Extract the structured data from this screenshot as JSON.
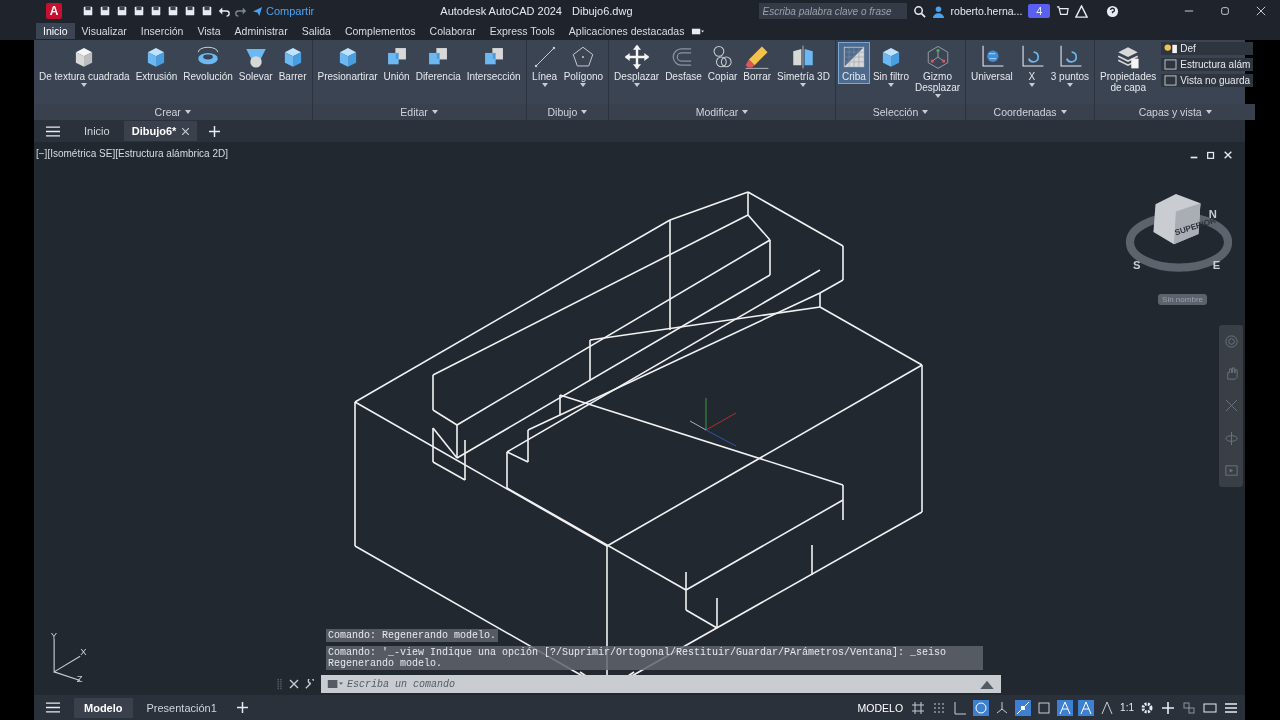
{
  "title_bar": {
    "app_logo": "A",
    "share": "Compartir",
    "title": "Autodesk AutoCAD 2024",
    "document": "Dibujo6.dwg",
    "search": {
      "placeholder": "Escriba palabra clave o frase"
    },
    "user": "roberto.herna...",
    "badge": "4"
  },
  "ribbon_tabs": [
    {
      "label": "Inicio",
      "selected": true
    },
    {
      "label": "Visualizar",
      "selected": false
    },
    {
      "label": "Inserción",
      "selected": false
    },
    {
      "label": "Vista",
      "selected": false
    },
    {
      "label": "Administrar",
      "selected": false
    },
    {
      "label": "Salida",
      "selected": false
    },
    {
      "label": "Complementos",
      "selected": false
    },
    {
      "label": "Colaborar",
      "selected": false
    },
    {
      "label": "Express Tools",
      "selected": false
    },
    {
      "label": "Aplicaciones destacadas",
      "selected": false
    }
  ],
  "ribbon_panels": [
    {
      "title": "Crear",
      "tools": [
        {
          "label": "De textura cuadrada",
          "kind": "cube",
          "selected": false,
          "dropdown": true
        },
        {
          "label": "Extrusión",
          "kind": "bluecube",
          "selected": false,
          "dropdown": false
        },
        {
          "label": "Revolución",
          "kind": "revolve",
          "selected": false,
          "dropdown": false
        },
        {
          "label": "Solevar",
          "kind": "loft",
          "selected": false,
          "dropdown": false
        },
        {
          "label": "Barrer",
          "kind": "bluecube",
          "selected": false,
          "dropdown": false
        }
      ]
    },
    {
      "title": "Editar",
      "tools": [
        {
          "label": "Presionartirar",
          "kind": "bluecube",
          "selected": false,
          "dropdown": false
        },
        {
          "label": "Unión",
          "kind": "union",
          "selected": false,
          "dropdown": false
        },
        {
          "label": "Diferencia",
          "kind": "union",
          "selected": false,
          "dropdown": false
        },
        {
          "label": "Intersección",
          "kind": "union",
          "selected": false,
          "dropdown": false
        }
      ]
    },
    {
      "title": "Dibujo",
      "tools": [
        {
          "label": "Línea",
          "kind": "line",
          "selected": false,
          "dropdown": true
        },
        {
          "label": "Polígono",
          "kind": "polygon",
          "selected": false,
          "dropdown": true
        }
      ]
    },
    {
      "title": "Modificar",
      "tools": [
        {
          "label": "Desplazar",
          "kind": "move",
          "selected": false,
          "dropdown": true
        },
        {
          "label": "Desfase",
          "kind": "offset",
          "selected": false,
          "dropdown": false
        },
        {
          "label": "Copiar",
          "kind": "copy",
          "selected": false,
          "dropdown": false
        },
        {
          "label": "Borrar",
          "kind": "erase",
          "selected": false,
          "dropdown": false
        },
        {
          "label": "Simetría 3D",
          "kind": "mirror",
          "selected": false,
          "dropdown": true
        }
      ]
    },
    {
      "title": "Selección",
      "tools": [
        {
          "label": "Criba",
          "kind": "grid",
          "selected": true,
          "dropdown": false
        },
        {
          "label": "Sin filtro",
          "kind": "bluecube",
          "selected": false,
          "dropdown": true
        },
        {
          "label": "Gizmo\nDesplazar",
          "kind": "gizmo",
          "selected": false,
          "dropdown": true
        }
      ]
    },
    {
      "title": "Coordenadas",
      "tools": [
        {
          "label": "Universal",
          "kind": "globe",
          "selected": false,
          "dropdown": false
        },
        {
          "label": "X",
          "kind": "axis",
          "selected": false,
          "dropdown": true
        },
        {
          "label": "3 puntos",
          "kind": "axis",
          "selected": false,
          "dropdown": true
        }
      ]
    },
    {
      "title": "Capas y vista",
      "tools": [
        {
          "label": "Propiedades\nde capa",
          "kind": "layers",
          "selected": false,
          "dropdown": false
        }
      ],
      "rows": [
        "Def",
        "Estructura alám",
        "Vista no guarda"
      ]
    }
  ],
  "file_tabs": [
    {
      "label": "Inicio",
      "selected": false
    },
    {
      "label": "Dibujo6*",
      "selected": true
    }
  ],
  "viewport": {
    "label": "[−][Isométrica SE][Estructura alámbrica 2D]",
    "viewcube": {
      "face": "SUPERIOR",
      "compass": [
        "N",
        "S",
        "E"
      ],
      "view_name": "Sin nombre"
    },
    "ucs": [
      "Y",
      "X",
      "Z"
    ]
  },
  "command_line": {
    "history": [
      "Comando:  Regenerando modelo.",
      "Comando: '_-view Indique una opción [?/Suprimir/Ortogonal/Restituir/Guardar/PArámetros/Ventana]: _seiso Regenerando modelo."
    ],
    "input": {
      "placeholder": "Escriba un comando"
    }
  },
  "status_bar": {
    "layout_tabs": [
      {
        "label": "Modelo",
        "selected": true
      },
      {
        "label": "Presentación1",
        "selected": false
      }
    ],
    "space": "MODELO",
    "scale": "1:1"
  }
}
